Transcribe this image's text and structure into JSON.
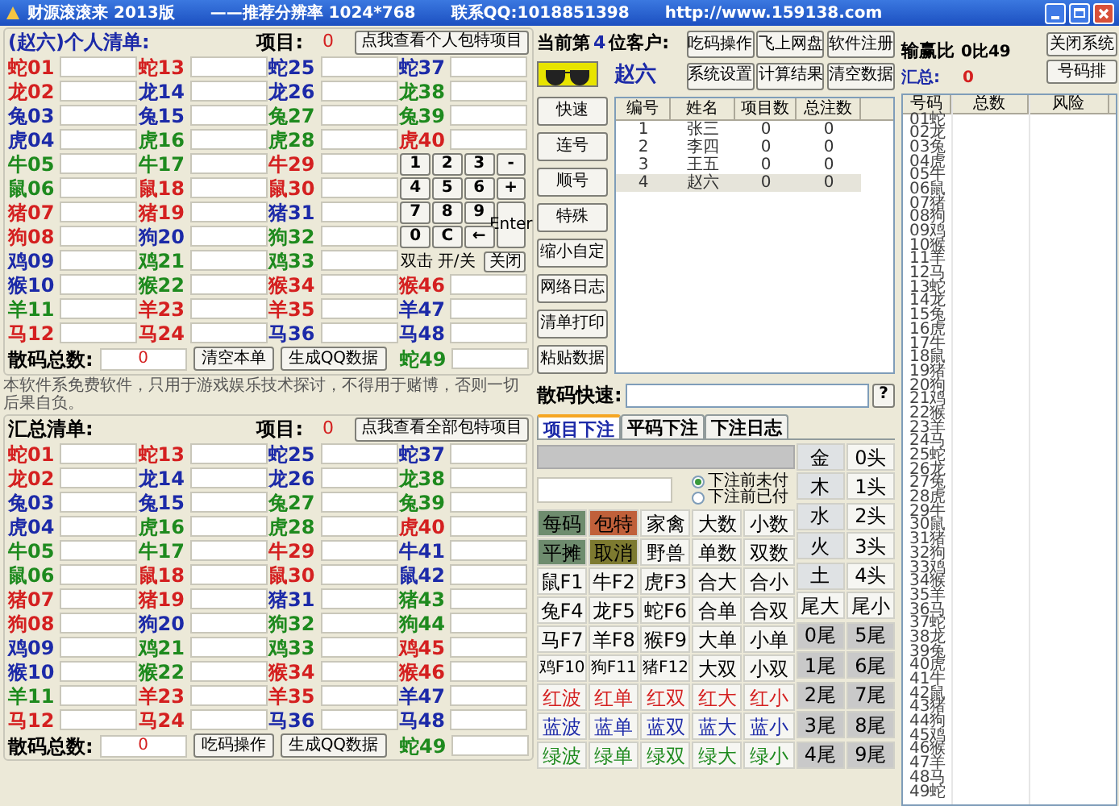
{
  "window": {
    "title": "财源滚滚来  2013版",
    "resolution": "——推荐分辨率 1024*768",
    "contact": "联系QQ:1018851398",
    "url": "http://www.159138.com"
  },
  "personal": {
    "heading": "(赵六)个人清单:",
    "item_label": "项目:",
    "item_count": "0",
    "view_button": "点我查看个人包特项目",
    "columns": [
      [
        {
          "label": "蛇01",
          "color": "#d42020"
        },
        {
          "label": "龙02",
          "color": "#d42020"
        },
        {
          "label": "兔03",
          "color": "#1c2aa8"
        },
        {
          "label": "虎04",
          "color": "#1c2aa8"
        },
        {
          "label": "牛05",
          "color": "#1e8a1e"
        },
        {
          "label": "鼠06",
          "color": "#1e8a1e"
        },
        {
          "label": "猪07",
          "color": "#d42020"
        },
        {
          "label": "狗08",
          "color": "#d42020"
        },
        {
          "label": "鸡09",
          "color": "#1c2aa8"
        },
        {
          "label": "猴10",
          "color": "#1c2aa8"
        },
        {
          "label": "羊11",
          "color": "#1e8a1e"
        },
        {
          "label": "马12",
          "color": "#d42020"
        }
      ],
      [
        {
          "label": "蛇13",
          "color": "#d42020"
        },
        {
          "label": "龙14",
          "color": "#1c2aa8"
        },
        {
          "label": "兔15",
          "color": "#1c2aa8"
        },
        {
          "label": "虎16",
          "color": "#1e8a1e"
        },
        {
          "label": "牛17",
          "color": "#1e8a1e"
        },
        {
          "label": "鼠18",
          "color": "#d42020"
        },
        {
          "label": "猪19",
          "color": "#d42020"
        },
        {
          "label": "狗20",
          "color": "#1c2aa8"
        },
        {
          "label": "鸡21",
          "color": "#1e8a1e"
        },
        {
          "label": "猴22",
          "color": "#1e8a1e"
        },
        {
          "label": "羊23",
          "color": "#d42020"
        },
        {
          "label": "马24",
          "color": "#d42020"
        }
      ],
      [
        {
          "label": "蛇25",
          "color": "#1c2aa8"
        },
        {
          "label": "龙26",
          "color": "#1c2aa8"
        },
        {
          "label": "兔27",
          "color": "#1e8a1e"
        },
        {
          "label": "虎28",
          "color": "#1e8a1e"
        },
        {
          "label": "牛29",
          "color": "#d42020"
        },
        {
          "label": "鼠30",
          "color": "#d42020"
        },
        {
          "label": "猪31",
          "color": "#1c2aa8"
        },
        {
          "label": "狗32",
          "color": "#1e8a1e"
        },
        {
          "label": "鸡33",
          "color": "#1e8a1e"
        },
        {
          "label": "猴34",
          "color": "#d42020"
        },
        {
          "label": "羊35",
          "color": "#d42020"
        },
        {
          "label": "马36",
          "color": "#1c2aa8"
        }
      ]
    ],
    "column_4_upper": [
      {
        "label": "蛇37",
        "color": "#1c2aa8"
      },
      {
        "label": "龙38",
        "color": "#1e8a1e"
      },
      {
        "label": "兔39",
        "color": "#1e8a1e"
      },
      {
        "label": "虎40",
        "color": "#d42020"
      }
    ],
    "column_4_lower": [
      {
        "label": "猴46",
        "color": "#d42020"
      },
      {
        "label": "羊47",
        "color": "#1c2aa8"
      },
      {
        "label": "马48",
        "color": "#1c2aa8"
      }
    ],
    "last": {
      "label": "蛇49",
      "color": "#1e8a1e"
    },
    "total_label": "散码总数:",
    "total_value": "0",
    "buttons": [
      "清空本单",
      "生成QQ数据"
    ]
  },
  "keypad": {
    "keys": [
      {
        "text": "1",
        "kind": "key"
      },
      {
        "text": "2",
        "kind": "key"
      },
      {
        "text": "3",
        "kind": "key"
      },
      {
        "text": "-",
        "kind": "key"
      },
      {
        "text": "4",
        "kind": "key"
      },
      {
        "text": "5",
        "kind": "key"
      },
      {
        "text": "6",
        "kind": "key"
      },
      {
        "text": "+",
        "kind": "key"
      },
      {
        "text": "7",
        "kind": "key"
      },
      {
        "text": "8",
        "kind": "key"
      },
      {
        "text": "9",
        "kind": "key"
      },
      {
        "text": "Enter",
        "kind": "tall"
      },
      {
        "text": "0",
        "kind": "key"
      },
      {
        "text": "C",
        "kind": "key"
      },
      {
        "text": "←",
        "kind": "key"
      }
    ],
    "hint": "双击 开/关",
    "close": "关闭"
  },
  "disclaimer": "本软件系免费软件，只用于游戏娱乐技术探讨，不得用于赌博，否则一切后果自负。",
  "summary": {
    "heading": "汇总清单:",
    "item_label": "项目:",
    "item_count": "0",
    "view_button": "点我查看全部包特项目",
    "columns": [
      [
        {
          "label": "蛇01",
          "color": "#d42020"
        },
        {
          "label": "龙02",
          "color": "#d42020"
        },
        {
          "label": "兔03",
          "color": "#1c2aa8"
        },
        {
          "label": "虎04",
          "color": "#1c2aa8"
        },
        {
          "label": "牛05",
          "color": "#1e8a1e"
        },
        {
          "label": "鼠06",
          "color": "#1e8a1e"
        },
        {
          "label": "猪07",
          "color": "#d42020"
        },
        {
          "label": "狗08",
          "color": "#d42020"
        },
        {
          "label": "鸡09",
          "color": "#1c2aa8"
        },
        {
          "label": "猴10",
          "color": "#1c2aa8"
        },
        {
          "label": "羊11",
          "color": "#1e8a1e"
        },
        {
          "label": "马12",
          "color": "#d42020"
        }
      ],
      [
        {
          "label": "蛇13",
          "color": "#d42020"
        },
        {
          "label": "龙14",
          "color": "#1c2aa8"
        },
        {
          "label": "兔15",
          "color": "#1c2aa8"
        },
        {
          "label": "虎16",
          "color": "#1e8a1e"
        },
        {
          "label": "牛17",
          "color": "#1e8a1e"
        },
        {
          "label": "鼠18",
          "color": "#d42020"
        },
        {
          "label": "猪19",
          "color": "#d42020"
        },
        {
          "label": "狗20",
          "color": "#1c2aa8"
        },
        {
          "label": "鸡21",
          "color": "#1e8a1e"
        },
        {
          "label": "猴22",
          "color": "#1e8a1e"
        },
        {
          "label": "羊23",
          "color": "#d42020"
        },
        {
          "label": "马24",
          "color": "#d42020"
        }
      ],
      [
        {
          "label": "蛇25",
          "color": "#1c2aa8"
        },
        {
          "label": "龙26",
          "color": "#1c2aa8"
        },
        {
          "label": "兔27",
          "color": "#1e8a1e"
        },
        {
          "label": "虎28",
          "color": "#1e8a1e"
        },
        {
          "label": "牛29",
          "color": "#d42020"
        },
        {
          "label": "鼠30",
          "color": "#d42020"
        },
        {
          "label": "猪31",
          "color": "#1c2aa8"
        },
        {
          "label": "狗32",
          "color": "#1e8a1e"
        },
        {
          "label": "鸡33",
          "color": "#1e8a1e"
        },
        {
          "label": "猴34",
          "color": "#d42020"
        },
        {
          "label": "羊35",
          "color": "#d42020"
        },
        {
          "label": "马36",
          "color": "#1c2aa8"
        }
      ],
      [
        {
          "label": "蛇37",
          "color": "#1c2aa8"
        },
        {
          "label": "龙38",
          "color": "#1e8a1e"
        },
        {
          "label": "兔39",
          "color": "#1e8a1e"
        },
        {
          "label": "虎40",
          "color": "#d42020"
        },
        {
          "label": "牛41",
          "color": "#1c2aa8"
        },
        {
          "label": "鼠42",
          "color": "#1c2aa8"
        },
        {
          "label": "猪43",
          "color": "#1e8a1e"
        },
        {
          "label": "狗44",
          "color": "#1e8a1e"
        },
        {
          "label": "鸡45",
          "color": "#d42020"
        },
        {
          "label": "猴46",
          "color": "#d42020"
        },
        {
          "label": "羊47",
          "color": "#1c2aa8"
        },
        {
          "label": "马48",
          "color": "#1c2aa8"
        }
      ]
    ],
    "last": {
      "label": "蛇49",
      "color": "#1e8a1e"
    },
    "total_label": "散码总数:",
    "total_value": "0",
    "buttons": [
      "吃码操作",
      "生成QQ数据"
    ]
  },
  "customer": {
    "prefix": "当前第",
    "number": "4",
    "suffix": "位客户:",
    "name": "赵六"
  },
  "top_buttons": [
    "吃码操作",
    "飞上网盘",
    "软件注册",
    "系统设置",
    "计算结果",
    "清空数据"
  ],
  "side_buttons": [
    "快速",
    "连号",
    "顺号",
    "特殊",
    "缩小自定",
    "网络日志",
    "清单打印",
    "粘贴数据"
  ],
  "customers": {
    "columns": [
      "编号",
      "姓名",
      "项目数",
      "总注数"
    ],
    "rows": [
      {
        "cells": [
          "1",
          "张三",
          "0",
          "0"
        ],
        "selected": false
      },
      {
        "cells": [
          "2",
          "李四",
          "0",
          "0"
        ],
        "selected": false
      },
      {
        "cells": [
          "3",
          "王五",
          "0",
          "0"
        ],
        "selected": false
      },
      {
        "cells": [
          "4",
          "赵六",
          "0",
          "0"
        ],
        "selected": true
      }
    ]
  },
  "quick_entry": {
    "label": "散码快速:",
    "help": "?"
  },
  "tabs": [
    {
      "label": "项目下注",
      "selected": true
    },
    {
      "label": "平码下注",
      "selected": false
    },
    {
      "label": "下注日志",
      "selected": false
    }
  ],
  "payment": [
    {
      "label": "下注前未付",
      "selected": true
    },
    {
      "label": "下注前已付",
      "selected": false
    }
  ],
  "bet_grid": [
    [
      {
        "text": "每码",
        "kind": "mode"
      },
      {
        "text": "包特",
        "kind": "special"
      },
      {
        "text": "家禽",
        "kind": "plain"
      },
      {
        "text": "大数",
        "kind": "plain"
      },
      {
        "text": "小数",
        "kind": "plain"
      }
    ],
    [
      {
        "text": "平摊",
        "kind": "mode"
      },
      {
        "text": "取消",
        "kind": "cancel"
      },
      {
        "text": "野兽",
        "kind": "plain"
      },
      {
        "text": "单数",
        "kind": "plain"
      },
      {
        "text": "双数",
        "kind": "plain"
      }
    ],
    [
      {
        "text": "鼠F1",
        "kind": "plain"
      },
      {
        "text": "牛F2",
        "kind": "plain"
      },
      {
        "text": "虎F3",
        "kind": "plain"
      },
      {
        "text": "合大",
        "kind": "plain"
      },
      {
        "text": "合小",
        "kind": "plain"
      }
    ],
    [
      {
        "text": "兔F4",
        "kind": "plain"
      },
      {
        "text": "龙F5",
        "kind": "plain"
      },
      {
        "text": "蛇F6",
        "kind": "plain"
      },
      {
        "text": "合单",
        "kind": "plain"
      },
      {
        "text": "合双",
        "kind": "plain"
      }
    ],
    [
      {
        "text": "马F7",
        "kind": "plain"
      },
      {
        "text": "羊F8",
        "kind": "plain"
      },
      {
        "text": "猴F9",
        "kind": "plain"
      },
      {
        "text": "大单",
        "kind": "plain"
      },
      {
        "text": "小单",
        "kind": "plain"
      }
    ],
    [
      {
        "text": "鸡F10",
        "kind": "plain"
      },
      {
        "text": "狗F11",
        "kind": "plain"
      },
      {
        "text": "猪F12",
        "kind": "plain"
      },
      {
        "text": "大双",
        "kind": "plain"
      },
      {
        "text": "小双",
        "kind": "plain"
      }
    ],
    [
      {
        "text": "红波",
        "kind": "red"
      },
      {
        "text": "红单",
        "kind": "red"
      },
      {
        "text": "红双",
        "kind": "red"
      },
      {
        "text": "红大",
        "kind": "red"
      },
      {
        "text": "红小",
        "kind": "red"
      }
    ],
    [
      {
        "text": "蓝波",
        "kind": "blue"
      },
      {
        "text": "蓝单",
        "kind": "blue"
      },
      {
        "text": "蓝双",
        "kind": "blue"
      },
      {
        "text": "蓝大",
        "kind": "blue"
      },
      {
        "text": "蓝小",
        "kind": "blue"
      }
    ],
    [
      {
        "text": "绿波",
        "kind": "green"
      },
      {
        "text": "绿单",
        "kind": "green"
      },
      {
        "text": "绿双",
        "kind": "green"
      },
      {
        "text": "绿大",
        "kind": "green"
      },
      {
        "text": "绿小",
        "kind": "green"
      }
    ]
  ],
  "side_grid": [
    [
      {
        "text": "金",
        "kind": "element"
      },
      {
        "text": "0头",
        "kind": "plain"
      }
    ],
    [
      {
        "text": "木",
        "kind": "element"
      },
      {
        "text": "1头",
        "kind": "plain"
      }
    ],
    [
      {
        "text": "水",
        "kind": "element"
      },
      {
        "text": "2头",
        "kind": "plain"
      }
    ],
    [
      {
        "text": "火",
        "kind": "element"
      },
      {
        "text": "3头",
        "kind": "plain"
      }
    ],
    [
      {
        "text": "土",
        "kind": "element"
      },
      {
        "text": "4头",
        "kind": "plain"
      }
    ],
    [
      {
        "text": "尾大",
        "kind": "plain"
      },
      {
        "text": "尾小",
        "kind": "plain"
      }
    ],
    [
      {
        "text": "0尾",
        "kind": "tail"
      },
      {
        "text": "5尾",
        "kind": "tail"
      }
    ],
    [
      {
        "text": "1尾",
        "kind": "tail"
      },
      {
        "text": "6尾",
        "kind": "tail"
      }
    ],
    [
      {
        "text": "2尾",
        "kind": "tail"
      },
      {
        "text": "7尾",
        "kind": "tail"
      }
    ],
    [
      {
        "text": "3尾",
        "kind": "tail"
      },
      {
        "text": "8尾",
        "kind": "tail"
      }
    ],
    [
      {
        "text": "4尾",
        "kind": "tail"
      },
      {
        "text": "9尾",
        "kind": "tail"
      }
    ]
  ],
  "stats": {
    "ratio_label": "输赢比",
    "ratio_value": "0比49",
    "total_label": "汇总:",
    "total_value": "0",
    "buttons": [
      "关闭系统",
      "号码排"
    ]
  },
  "ranking": {
    "columns": [
      "号码",
      "总数",
      "风险"
    ],
    "rows": [
      "01蛇",
      "02龙",
      "03兔",
      "04虎",
      "05牛",
      "06鼠",
      "07猪",
      "08狗",
      "09鸡",
      "10猴",
      "11羊",
      "12马",
      "13蛇",
      "14龙",
      "15兔",
      "16虎",
      "17牛",
      "18鼠",
      "19猪",
      "20狗",
      "21鸡",
      "22猴",
      "23羊",
      "24马",
      "25蛇",
      "26龙",
      "27兔",
      "28虎",
      "29牛",
      "30鼠",
      "31猪",
      "32狗",
      "33鸡",
      "34猴",
      "35羊",
      "36马",
      "37蛇",
      "38龙",
      "39兔",
      "40虎",
      "41牛",
      "42鼠",
      "43猪",
      "44狗",
      "45鸡",
      "46猴",
      "47羊",
      "48马",
      "49蛇"
    ]
  }
}
